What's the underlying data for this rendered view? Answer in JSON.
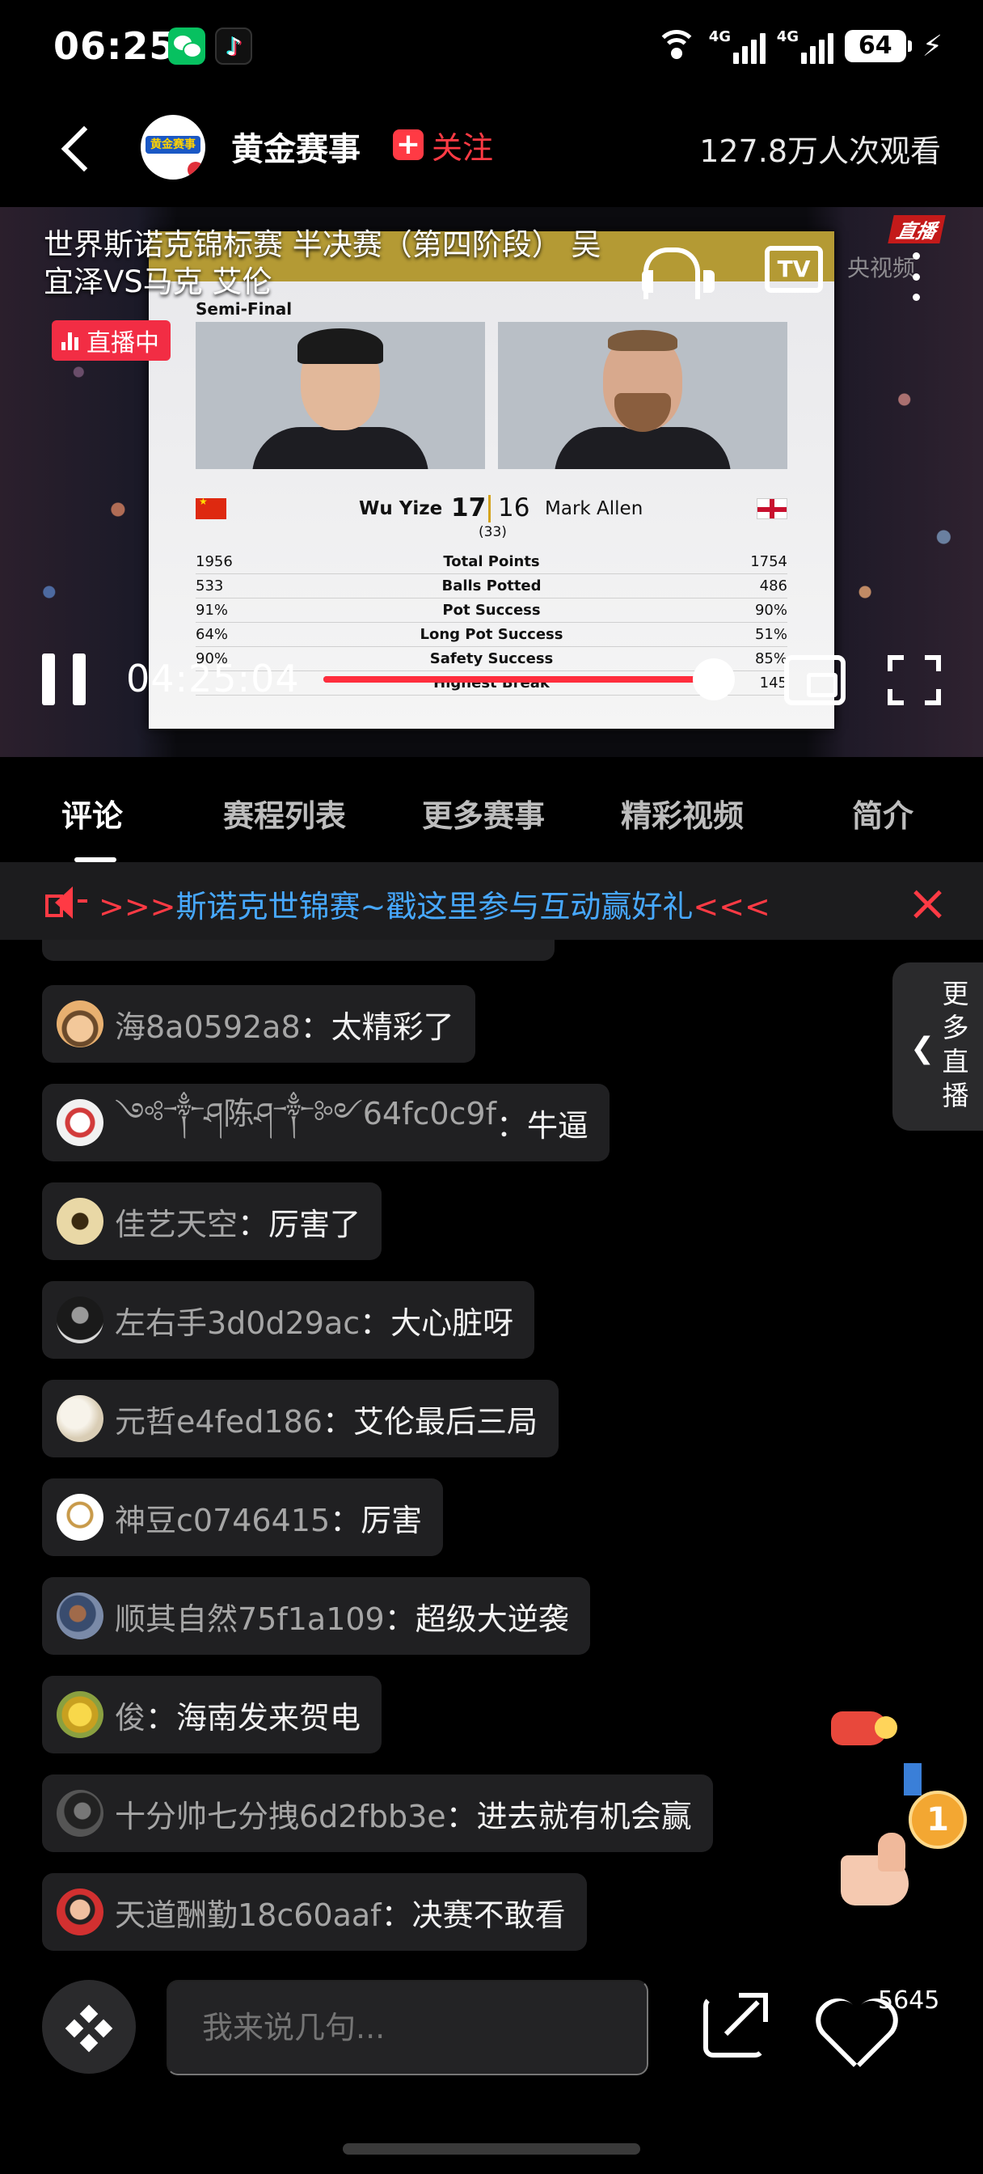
{
  "status_bar": {
    "time": "06:25",
    "net1": "4G",
    "net2": "4G",
    "battery": "64"
  },
  "header": {
    "channel_name": "黄金赛事",
    "avatar_text": "黄金赛事",
    "follow_label": "关注",
    "viewers": "127.8万人次观看"
  },
  "video": {
    "title": "世界斯诺克锦标赛 半决赛（第四阶段） 吴宜泽VS马克 艾伦",
    "live_label": "直播中",
    "tv_label": "TV",
    "channel_watermark": "央视频",
    "live_tag": "直播",
    "current_time": "04:25:04",
    "progress_fraction": 0.97,
    "scoreboard": {
      "stage": "Semi-Final",
      "player1": "Wu Yize",
      "player2": "Mark Allen",
      "score1": "17",
      "score2": "16",
      "frames": "(33)",
      "stats": [
        {
          "p1": "1956",
          "label": "Total Points",
          "p2": "1754"
        },
        {
          "p1": "533",
          "label": "Balls Potted",
          "p2": "486"
        },
        {
          "p1": "91%",
          "label": "Pot Success",
          "p2": "90%"
        },
        {
          "p1": "64%",
          "label": "Long Pot Success",
          "p2": "51%"
        },
        {
          "p1": "90%",
          "label": "Safety Success",
          "p2": "85%"
        },
        {
          "p1": "",
          "label": "Highest Break",
          "p2": "145"
        }
      ]
    }
  },
  "tabs": [
    {
      "label": "评论",
      "active": true
    },
    {
      "label": "赛程列表",
      "active": false
    },
    {
      "label": "更多赛事",
      "active": false
    },
    {
      "label": "精彩视频",
      "active": false
    },
    {
      "label": "简介",
      "active": false
    }
  ],
  "notice": {
    "prefix": ">>>",
    "text": "斯诺克世锦赛~戳这里参与互动赢好礼",
    "suffix": "<<<"
  },
  "comments": [
    {
      "user": "海8a0592a8",
      "msg": "太精彩了"
    },
    {
      "user": "༺༒ཤ陈ཤ༒༻64fc0c9f",
      "msg": "牛逼"
    },
    {
      "user": "佳艺天空",
      "msg": "厉害了"
    },
    {
      "user": "左右手3d0d29ac",
      "msg": "大心脏呀"
    },
    {
      "user": "元哲e4fed186",
      "msg": "艾伦最后三局"
    },
    {
      "user": "神豆c0746415",
      "msg": "厉害"
    },
    {
      "user": "顺其自然75f1a109",
      "msg": "超级大逆袭"
    },
    {
      "user": "俊",
      "msg": "海南发来贺电"
    },
    {
      "user": "十分帅七分拽6d2fbb3e",
      "msg": "进去就有机会赢"
    },
    {
      "user": "天道酬勤18c60aaf",
      "msg": "决赛不敢看"
    }
  ],
  "side_panel": {
    "label": "更多直播"
  },
  "input": {
    "placeholder": "我来说几句..."
  },
  "likes": {
    "count": "5645"
  },
  "colors": {
    "accent_red": "#ff3a44",
    "notice_blue": "#47a8ff",
    "progress": "#ff2d3d"
  }
}
